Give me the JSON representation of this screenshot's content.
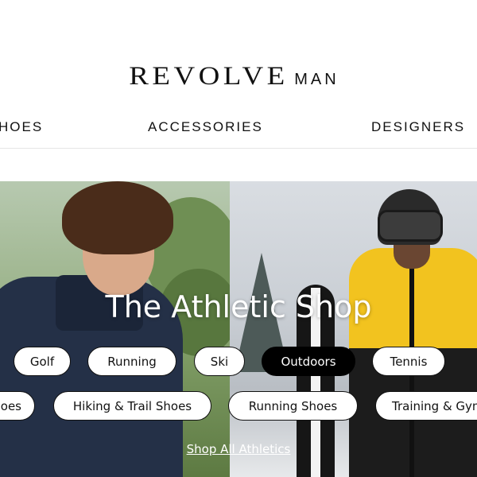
{
  "brand": {
    "name": "REVOLVE",
    "sub": "MAN"
  },
  "nav": {
    "items": [
      "HOES",
      "ACCESSORIES",
      "DESIGNERS"
    ]
  },
  "hero": {
    "title": "The Athletic Shop",
    "sports": [
      "Golf",
      "Running",
      "Ski",
      "Outdoors",
      "Tennis"
    ],
    "active_sport": "Outdoors",
    "categories": [
      "oes",
      "Hiking & Trail Shoes",
      "Running Shoes",
      "Training & Gym"
    ],
    "cta": "Shop All Athletics"
  }
}
